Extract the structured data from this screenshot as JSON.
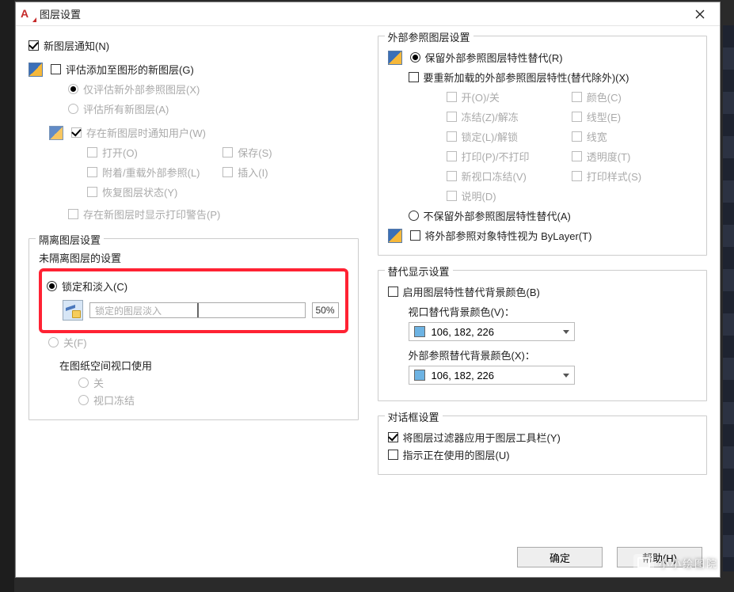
{
  "window": {
    "title": "图层设置"
  },
  "left": {
    "new_layer_notify": "新图层通知(N)",
    "eval_added": "评估添加至图形的新图层(G)",
    "eval_xref_only": "仅评估新外部参照图层(X)",
    "eval_all_new": "评估所有新图层(A)",
    "notify_user": "存在新图层时通知用户(W)",
    "open": "打开(O)",
    "save": "保存(S)",
    "attach_reload": "附着/重载外部参照(L)",
    "insert": "插入(I)",
    "restore_state": "恢复图层状态(Y)",
    "print_warning": "存在新图层时显示打印警告(P)",
    "isolate": {
      "legend": "隔离图层设置",
      "not_isolated": "未隔离图层的设置",
      "lock_fade": "锁定和淡入(C)",
      "locked_fade_placeholder": "锁定的图层淡入",
      "locked_fade_value": "50%",
      "off": "关(F)",
      "use_paper_vp": "在图纸空间视口使用",
      "use_off": "关",
      "use_vp_freeze": "视口冻结"
    }
  },
  "right": {
    "xref": {
      "legend": "外部参照图层设置",
      "retain_overrides": "保留外部参照图层特性替代(R)",
      "reload_props": "要重新加载的外部参照图层特性(替代除外)(X)",
      "on_off": "开(O)/关",
      "color": "颜色(C)",
      "freeze": "冻结(Z)/解冻",
      "linetype": "线型(E)",
      "lock": "锁定(L)/解锁",
      "lineweight": "线宽",
      "plot": "打印(P)/不打印",
      "transparency": "透明度(T)",
      "new_vp_freeze": "新视口冻结(V)",
      "plot_style": "打印样式(S)",
      "desc": "说明(D)",
      "not_retain": "不保留外部参照图层特性替代(A)",
      "treat_bylayer": "将外部参照对象特性视为 ByLayer(T)"
    },
    "override": {
      "legend": "替代显示设置",
      "enable_bg": "启用图层特性替代背景颜色(B)",
      "vp_bg_color_label": "视口替代背景颜色(V)：",
      "vp_bg_color_value": "106, 182, 226",
      "xref_bg_color_label": "外部参照替代背景颜色(X)：",
      "xref_bg_color_value": "106, 182, 226"
    },
    "dialog": {
      "legend": "对话框设置",
      "apply_filters": "将图层过滤器应用于图层工具栏(Y)",
      "indicate_in_use": "指示正在使用的图层(U)"
    }
  },
  "buttons": {
    "ok": "确定",
    "help": "帮助(H)"
  },
  "watermark": "小小绘图院"
}
